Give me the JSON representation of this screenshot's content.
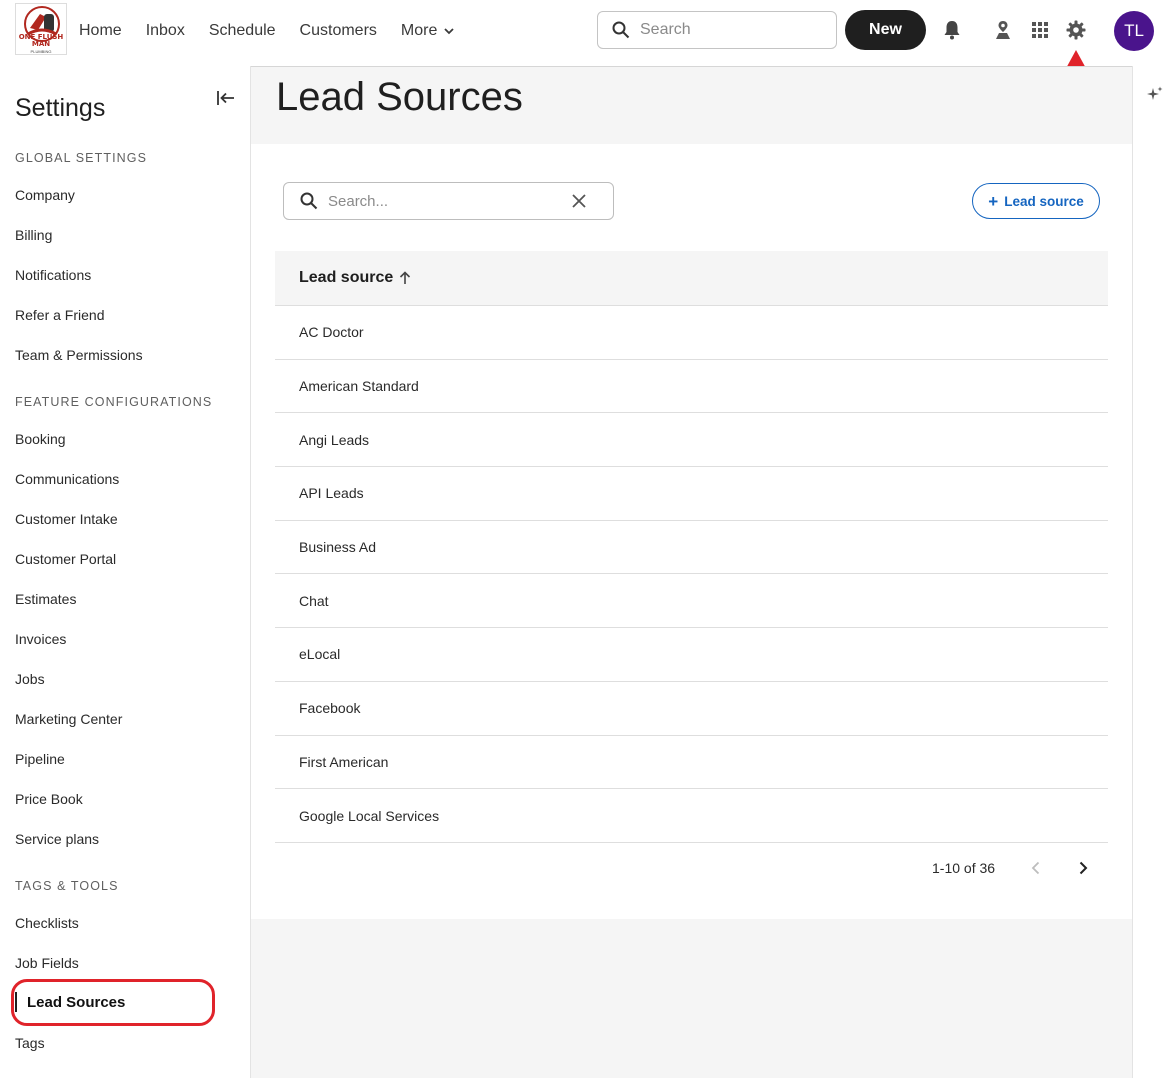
{
  "brand": {
    "logo_text": "ONE FLUSH MAN",
    "logo_sub": "PLUMBING"
  },
  "nav": {
    "items": [
      "Home",
      "Inbox",
      "Schedule",
      "Customers",
      "More"
    ]
  },
  "top_search": {
    "placeholder": "Search"
  },
  "new_button": "New",
  "avatar_initials": "TL",
  "icons": [
    "bell-icon",
    "map-pin-icon",
    "apps-grid-icon",
    "gear-icon",
    "sparkle-icon"
  ],
  "sidebar": {
    "title": "Settings",
    "sections": {
      "global": "GLOBAL SETTINGS",
      "features": "FEATURE CONFIGURATIONS",
      "tags": "TAGS & TOOLS"
    },
    "global_items": [
      "Company",
      "Billing",
      "Notifications",
      "Refer a Friend",
      "Team & Permissions"
    ],
    "feature_items": [
      "Booking",
      "Communications",
      "Customer Intake",
      "Customer Portal",
      "Estimates",
      "Invoices",
      "Jobs",
      "Marketing Center",
      "Pipeline",
      "Price Book",
      "Service plans"
    ],
    "tools_items": [
      "Checklists",
      "Job Fields",
      "Lead Sources",
      "Tags"
    ],
    "active": "Lead Sources"
  },
  "main": {
    "title": "Lead Sources",
    "search_placeholder": "Search...",
    "add_button": "Lead source",
    "column_header": "Lead source",
    "rows": [
      "AC Doctor",
      "American Standard",
      "Angi Leads",
      "API Leads",
      "Business Ad",
      "Chat",
      "eLocal",
      "Facebook",
      "First American",
      "Google Local Services"
    ],
    "pagination": "1-10 of 36"
  },
  "colors": {
    "accent": "#1565c0",
    "avatar": "#4a148c",
    "annotation": "#e0232a"
  }
}
